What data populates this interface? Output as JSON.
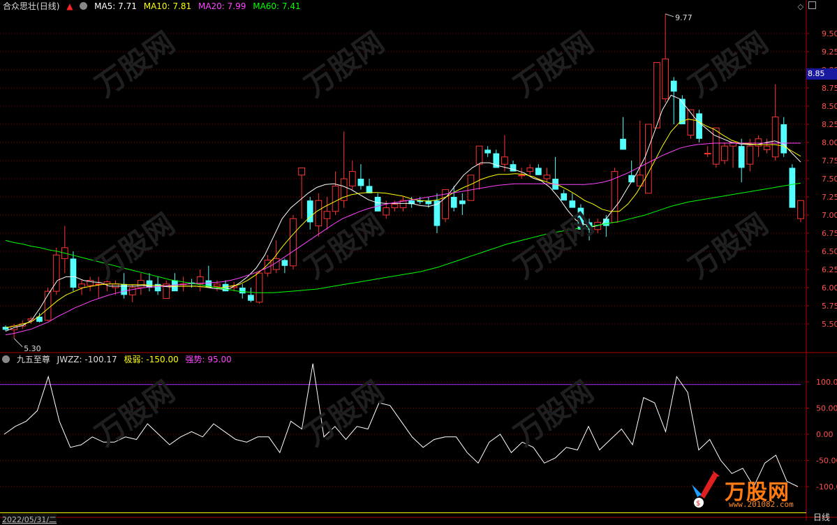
{
  "stock": {
    "name": "合众思壮",
    "period": "(日线)"
  },
  "ma_legend": [
    {
      "label": "MA5: 7.71",
      "color": "#ffffff"
    },
    {
      "label": "MA10: 7.81",
      "color": "#ffff00"
    },
    {
      "label": "MA20: 7.99",
      "color": "#ff44ff"
    },
    {
      "label": "MA60: 7.41",
      "color": "#00ff00"
    }
  ],
  "indicator": {
    "name": "九五至尊",
    "jwzz": "JWZZ: -100.17",
    "weak": "极弱: -150.00",
    "strong": "强势: 95.00"
  },
  "price_axis": {
    "ticks": [
      "9.50",
      "9.25",
      "9.00",
      "8.75",
      "8.50",
      "8.25",
      "8.00",
      "7.75",
      "7.50",
      "7.25",
      "7.00",
      "6.75",
      "6.50",
      "6.25",
      "6.00",
      "5.75",
      "5.50"
    ],
    "current": "8.85"
  },
  "ind_axis": {
    "ticks": [
      "100.00",
      "50.00",
      "0.00",
      "-50.00",
      "-100.00"
    ]
  },
  "annotations": {
    "high": "9.77",
    "low": "5.30"
  },
  "footer": {
    "date": "2022/05/31/二",
    "period_btn": "日线"
  },
  "watermark": {
    "text": "万股网",
    "site": "www.201082.com"
  },
  "colors": {
    "up": "#ff3333",
    "down": "#54ffff",
    "grid": "#8b0000"
  },
  "chart_data": [
    {
      "type": "candlestick",
      "title": "合众思壮 (日线)",
      "ylim": [
        5.2,
        9.8
      ],
      "candles": [
        {
          "o": 5.46,
          "h": 5.48,
          "l": 5.4,
          "c": 5.42
        },
        {
          "o": 5.42,
          "h": 5.5,
          "l": 5.3,
          "c": 5.47
        },
        {
          "o": 5.47,
          "h": 5.55,
          "l": 5.43,
          "c": 5.5
        },
        {
          "o": 5.55,
          "h": 5.6,
          "l": 5.5,
          "c": 5.57
        },
        {
          "o": 5.6,
          "h": 5.65,
          "l": 5.52,
          "c": 5.53
        },
        {
          "o": 5.55,
          "h": 6.0,
          "l": 5.54,
          "c": 5.95
        },
        {
          "o": 5.95,
          "h": 6.55,
          "l": 5.9,
          "c": 6.45
        },
        {
          "o": 6.4,
          "h": 6.85,
          "l": 6.2,
          "c": 6.55
        },
        {
          "o": 6.4,
          "h": 6.5,
          "l": 5.95,
          "c": 6.0
        },
        {
          "o": 6.0,
          "h": 6.1,
          "l": 5.9,
          "c": 6.05
        },
        {
          "o": 6.03,
          "h": 6.15,
          "l": 5.95,
          "c": 6.1
        },
        {
          "o": 6.05,
          "h": 6.15,
          "l": 5.85,
          "c": 6.05
        },
        {
          "o": 6.05,
          "h": 6.1,
          "l": 5.95,
          "c": 6.08
        },
        {
          "o": 6.0,
          "h": 6.1,
          "l": 5.9,
          "c": 6.05
        },
        {
          "o": 6.05,
          "h": 6.2,
          "l": 5.85,
          "c": 5.9
        },
        {
          "o": 5.9,
          "h": 6.05,
          "l": 5.8,
          "c": 6.0
        },
        {
          "o": 6.0,
          "h": 6.2,
          "l": 5.9,
          "c": 6.1
        },
        {
          "o": 6.1,
          "h": 6.2,
          "l": 5.95,
          "c": 6.0
        },
        {
          "o": 6.05,
          "h": 6.15,
          "l": 5.9,
          "c": 5.95
        },
        {
          "o": 5.85,
          "h": 6.1,
          "l": 5.85,
          "c": 6.05
        },
        {
          "o": 6.1,
          "h": 6.2,
          "l": 6.0,
          "c": 5.95
        },
        {
          "o": 6.05,
          "h": 6.15,
          "l": 5.95,
          "c": 6.05
        },
        {
          "o": 6.07,
          "h": 6.12,
          "l": 6.0,
          "c": 6.05
        },
        {
          "o": 6.05,
          "h": 6.25,
          "l": 5.95,
          "c": 6.15
        },
        {
          "o": 6.1,
          "h": 6.3,
          "l": 6.0,
          "c": 6.0
        },
        {
          "o": 6.02,
          "h": 6.1,
          "l": 5.95,
          "c": 6.05
        },
        {
          "o": 6.05,
          "h": 6.1,
          "l": 5.95,
          "c": 5.95
        },
        {
          "o": 6.0,
          "h": 6.08,
          "l": 5.95,
          "c": 6.02
        },
        {
          "o": 6.0,
          "h": 6.05,
          "l": 5.85,
          "c": 5.92
        },
        {
          "o": 5.9,
          "h": 6.0,
          "l": 5.8,
          "c": 5.82
        },
        {
          "o": 5.8,
          "h": 6.1,
          "l": 5.78,
          "c": 6.2
        },
        {
          "o": 6.2,
          "h": 6.45,
          "l": 6.15,
          "c": 6.38
        },
        {
          "o": 6.25,
          "h": 6.65,
          "l": 6.2,
          "c": 6.4
        },
        {
          "o": 6.38,
          "h": 6.4,
          "l": 6.2,
          "c": 6.3
        },
        {
          "o": 6.3,
          "h": 7.0,
          "l": 6.25,
          "c": 6.95
        },
        {
          "o": 7.55,
          "h": 7.65,
          "l": 6.95,
          "c": 7.65
        },
        {
          "o": 7.2,
          "h": 7.25,
          "l": 6.8,
          "c": 6.9
        },
        {
          "o": 6.85,
          "h": 7.3,
          "l": 6.7,
          "c": 7.2
        },
        {
          "o": 6.95,
          "h": 7.25,
          "l": 6.8,
          "c": 7.05
        },
        {
          "o": 7.05,
          "h": 7.6,
          "l": 7.0,
          "c": 7.4
        },
        {
          "o": 7.2,
          "h": 8.15,
          "l": 7.1,
          "c": 7.5
        },
        {
          "o": 7.4,
          "h": 7.75,
          "l": 7.35,
          "c": 7.6
        },
        {
          "o": 7.5,
          "h": 7.7,
          "l": 7.35,
          "c": 7.4
        },
        {
          "o": 7.4,
          "h": 7.5,
          "l": 7.3,
          "c": 7.3
        },
        {
          "o": 7.25,
          "h": 7.3,
          "l": 7.05,
          "c": 7.05
        },
        {
          "o": 7.0,
          "h": 7.2,
          "l": 6.95,
          "c": 7.1
        },
        {
          "o": 7.1,
          "h": 7.2,
          "l": 7.05,
          "c": 7.15
        },
        {
          "o": 7.1,
          "h": 7.25,
          "l": 7.05,
          "c": 7.2
        },
        {
          "o": 7.2,
          "h": 7.25,
          "l": 7.1,
          "c": 7.15
        },
        {
          "o": 7.2,
          "h": 7.25,
          "l": 7.15,
          "c": 7.18
        },
        {
          "o": 7.2,
          "h": 7.25,
          "l": 7.1,
          "c": 7.15
        },
        {
          "o": 7.2,
          "h": 7.3,
          "l": 6.75,
          "c": 6.85
        },
        {
          "o": 6.95,
          "h": 7.35,
          "l": 6.9,
          "c": 7.35
        },
        {
          "o": 7.25,
          "h": 7.4,
          "l": 7.05,
          "c": 7.1
        },
        {
          "o": 7.2,
          "h": 7.3,
          "l": 7.0,
          "c": 7.15
        },
        {
          "o": 7.2,
          "h": 7.55,
          "l": 7.2,
          "c": 7.55
        },
        {
          "o": 7.7,
          "h": 7.95,
          "l": 7.35,
          "c": 7.95
        },
        {
          "o": 7.9,
          "h": 7.95,
          "l": 7.8,
          "c": 7.85
        },
        {
          "o": 7.85,
          "h": 7.9,
          "l": 7.7,
          "c": 7.65
        },
        {
          "o": 7.7,
          "h": 8.1,
          "l": 7.6,
          "c": 7.8
        },
        {
          "o": 7.7,
          "h": 7.75,
          "l": 7.6,
          "c": 7.6
        },
        {
          "o": 7.55,
          "h": 7.65,
          "l": 7.5,
          "c": 7.55
        },
        {
          "o": 7.6,
          "h": 7.7,
          "l": 7.55,
          "c": 7.65
        },
        {
          "o": 7.65,
          "h": 7.7,
          "l": 7.55,
          "c": 7.55
        },
        {
          "o": 7.5,
          "h": 7.65,
          "l": 7.45,
          "c": 7.55
        },
        {
          "o": 7.5,
          "h": 7.8,
          "l": 7.35,
          "c": 7.35
        },
        {
          "o": 7.3,
          "h": 7.35,
          "l": 7.25,
          "c": 7.2
        },
        {
          "o": 7.2,
          "h": 7.3,
          "l": 7.1,
          "c": 7.1
        },
        {
          "o": 7.1,
          "h": 7.15,
          "l": 6.8,
          "c": 6.8
        },
        {
          "o": 6.9,
          "h": 6.95,
          "l": 6.65,
          "c": 6.8
        },
        {
          "o": 6.8,
          "h": 6.95,
          "l": 6.75,
          "c": 6.9
        },
        {
          "o": 6.95,
          "h": 7.0,
          "l": 6.7,
          "c": 6.85
        },
        {
          "o": 6.9,
          "h": 7.65,
          "l": 6.9,
          "c": 7.6
        },
        {
          "o": 8.05,
          "h": 8.35,
          "l": 7.9,
          "c": 7.9
        },
        {
          "o": 7.55,
          "h": 7.75,
          "l": 7.45,
          "c": 7.45
        },
        {
          "o": 7.4,
          "h": 8.3,
          "l": 7.4,
          "c": 7.55
        },
        {
          "o": 7.3,
          "h": 8.25,
          "l": 7.3,
          "c": 8.25
        },
        {
          "o": 8.2,
          "h": 9.1,
          "l": 8.2,
          "c": 9.1
        },
        {
          "o": 8.6,
          "h": 9.77,
          "l": 8.55,
          "c": 9.15
        },
        {
          "o": 8.85,
          "h": 8.9,
          "l": 8.25,
          "c": 8.7
        },
        {
          "o": 8.6,
          "h": 8.65,
          "l": 8.25,
          "c": 8.25
        },
        {
          "o": 8.1,
          "h": 8.35,
          "l": 8.05,
          "c": 8.45
        },
        {
          "o": 8.4,
          "h": 8.45,
          "l": 8.0,
          "c": 8.05
        },
        {
          "o": 7.85,
          "h": 7.95,
          "l": 7.8,
          "c": 7.85
        },
        {
          "o": 7.7,
          "h": 8.0,
          "l": 7.65,
          "c": 8.2
        },
        {
          "o": 7.75,
          "h": 8.0,
          "l": 7.7,
          "c": 7.95
        },
        {
          "o": 7.95,
          "h": 8.0,
          "l": 7.65,
          "c": 8.0
        },
        {
          "o": 7.95,
          "h": 8.05,
          "l": 7.45,
          "c": 7.65
        },
        {
          "o": 7.7,
          "h": 8.05,
          "l": 7.6,
          "c": 7.95
        },
        {
          "o": 7.95,
          "h": 8.1,
          "l": 7.8,
          "c": 8.05
        },
        {
          "o": 7.9,
          "h": 8.05,
          "l": 7.85,
          "c": 7.95
        },
        {
          "o": 7.8,
          "h": 8.8,
          "l": 7.75,
          "c": 8.35
        },
        {
          "o": 8.25,
          "h": 8.35,
          "l": 7.8,
          "c": 7.85
        },
        {
          "o": 7.65,
          "h": 7.7,
          "l": 7.1,
          "c": 7.1
        },
        {
          "o": 6.95,
          "h": 7.2,
          "l": 6.9,
          "c": 7.2
        }
      ],
      "ma": {
        "MA5": [
          5.4,
          5.45,
          5.48,
          5.55,
          5.72,
          5.92,
          6.1,
          6.15,
          6.15,
          6.1,
          6.08,
          6.07,
          6.02,
          6.02,
          6.02,
          6.02,
          6.03,
          6.01,
          6.02,
          6.01,
          6.02,
          6.02,
          6.02,
          6.01,
          5.99,
          5.98,
          5.99,
          6.06,
          6.15,
          6.27,
          6.45,
          6.7,
          6.95,
          7.1,
          7.2,
          7.3,
          7.38,
          7.42,
          7.43,
          7.4,
          7.35,
          7.28,
          7.21,
          7.17,
          7.16,
          7.16,
          7.16,
          7.16,
          7.13,
          7.12,
          7.15,
          7.25,
          7.4,
          7.55,
          7.65,
          7.72,
          7.72,
          7.68,
          7.65,
          7.62,
          7.58,
          7.51,
          7.47,
          7.38,
          7.24,
          7.07,
          6.93,
          6.87,
          6.84,
          6.87,
          7.03,
          7.18,
          7.38,
          7.57,
          7.8,
          8.12,
          8.45,
          8.65,
          8.6,
          8.45,
          8.3,
          8.2,
          8.1,
          8.05,
          8.0,
          7.98,
          7.97,
          7.97,
          8.0,
          8.02,
          7.98,
          7.85,
          7.73
        ],
        "MA10": [
          5.45,
          5.47,
          5.5,
          5.53,
          5.62,
          5.72,
          5.82,
          5.9,
          5.95,
          6.0,
          6.02,
          6.04,
          6.05,
          6.05,
          6.04,
          6.04,
          6.04,
          6.03,
          6.03,
          6.02,
          6.02,
          6.02,
          6.02,
          6.01,
          6.01,
          6.0,
          6.02,
          6.04,
          6.1,
          6.18,
          6.28,
          6.4,
          6.56,
          6.7,
          6.83,
          6.95,
          7.05,
          7.12,
          7.18,
          7.24,
          7.28,
          7.3,
          7.31,
          7.31,
          7.3,
          7.28,
          7.26,
          7.22,
          7.2,
          7.19,
          7.21,
          7.25,
          7.32,
          7.38,
          7.43,
          7.49,
          7.53,
          7.56,
          7.56,
          7.57,
          7.56,
          7.53,
          7.48,
          7.44,
          7.41,
          7.35,
          7.28,
          7.2,
          7.15,
          7.08,
          7.05,
          7.05,
          7.15,
          7.3,
          7.5,
          7.72,
          7.95,
          8.15,
          8.28,
          8.32,
          8.3,
          8.23,
          8.18,
          8.1,
          8.03,
          7.99,
          7.98,
          7.97,
          7.97,
          7.97,
          7.95,
          7.88,
          7.81
        ],
        "MA20": [
          5.35,
          5.37,
          5.4,
          5.43,
          5.48,
          5.53,
          5.6,
          5.66,
          5.72,
          5.77,
          5.82,
          5.86,
          5.9,
          5.93,
          5.96,
          5.98,
          6.0,
          6.01,
          6.02,
          6.03,
          6.04,
          6.05,
          6.06,
          6.06,
          6.07,
          6.08,
          6.1,
          6.13,
          6.17,
          6.21,
          6.26,
          6.32,
          6.4,
          6.48,
          6.56,
          6.64,
          6.72,
          6.8,
          6.88,
          6.95,
          7.0,
          7.05,
          7.09,
          7.12,
          7.15,
          7.17,
          7.19,
          7.21,
          7.23,
          7.25,
          7.27,
          7.29,
          7.31,
          7.33,
          7.35,
          7.37,
          7.39,
          7.41,
          7.42,
          7.43,
          7.43,
          7.43,
          7.43,
          7.43,
          7.42,
          7.42,
          7.42,
          7.42,
          7.43,
          7.45,
          7.48,
          7.53,
          7.58,
          7.64,
          7.7,
          7.76,
          7.82,
          7.87,
          7.92,
          7.95,
          7.97,
          7.98,
          7.99,
          7.99,
          7.99,
          7.99,
          7.99,
          7.99,
          7.99,
          7.99,
          7.99,
          7.99,
          7.99
        ],
        "MA60": [
          6.65,
          6.62,
          6.6,
          6.57,
          6.55,
          6.52,
          6.5,
          6.47,
          6.44,
          6.41,
          6.38,
          6.35,
          6.32,
          6.29,
          6.26,
          6.23,
          6.2,
          6.17,
          6.14,
          6.11,
          6.09,
          6.07,
          6.05,
          6.03,
          6.01,
          5.99,
          5.97,
          5.95,
          5.94,
          5.93,
          5.93,
          5.93,
          5.94,
          5.95,
          5.96,
          5.97,
          5.98,
          6.0,
          6.02,
          6.04,
          6.06,
          6.08,
          6.1,
          6.12,
          6.14,
          6.16,
          6.18,
          6.2,
          6.22,
          6.25,
          6.28,
          6.32,
          6.36,
          6.4,
          6.44,
          6.48,
          6.52,
          6.56,
          6.6,
          6.63,
          6.66,
          6.69,
          6.72,
          6.75,
          6.77,
          6.79,
          6.81,
          6.83,
          6.85,
          6.87,
          6.89,
          6.91,
          6.94,
          6.97,
          7.0,
          7.04,
          7.08,
          7.12,
          7.15,
          7.18,
          7.2,
          7.22,
          7.24,
          7.26,
          7.28,
          7.3,
          7.32,
          7.34,
          7.36,
          7.38,
          7.4,
          7.42,
          7.44
        ]
      }
    },
    {
      "type": "line",
      "title": "九五至尊",
      "ylim": [
        -125,
        140
      ],
      "series": [
        {
          "name": "JWZZ",
          "values": [
            0,
            15,
            25,
            45,
            110,
            25,
            -25,
            -20,
            -5,
            -15,
            -15,
            -5,
            -10,
            20,
            0,
            -20,
            -5,
            5,
            -5,
            20,
            5,
            -10,
            -15,
            -5,
            -5,
            -35,
            25,
            10,
            135,
            -5,
            15,
            -10,
            15,
            10,
            60,
            55,
            25,
            -5,
            -25,
            -10,
            -5,
            -5,
            -35,
            -55,
            -15,
            0,
            -35,
            -15,
            -25,
            -55,
            -45,
            -25,
            -30,
            15,
            -30,
            -10,
            10,
            -20,
            70,
            60,
            5,
            110,
            80,
            -30,
            -10,
            -50,
            -75,
            -65,
            -100,
            -55,
            -40,
            -90,
            -100
          ]
        }
      ],
      "markers": {
        "weak": -150,
        "strong": 95
      }
    }
  ]
}
